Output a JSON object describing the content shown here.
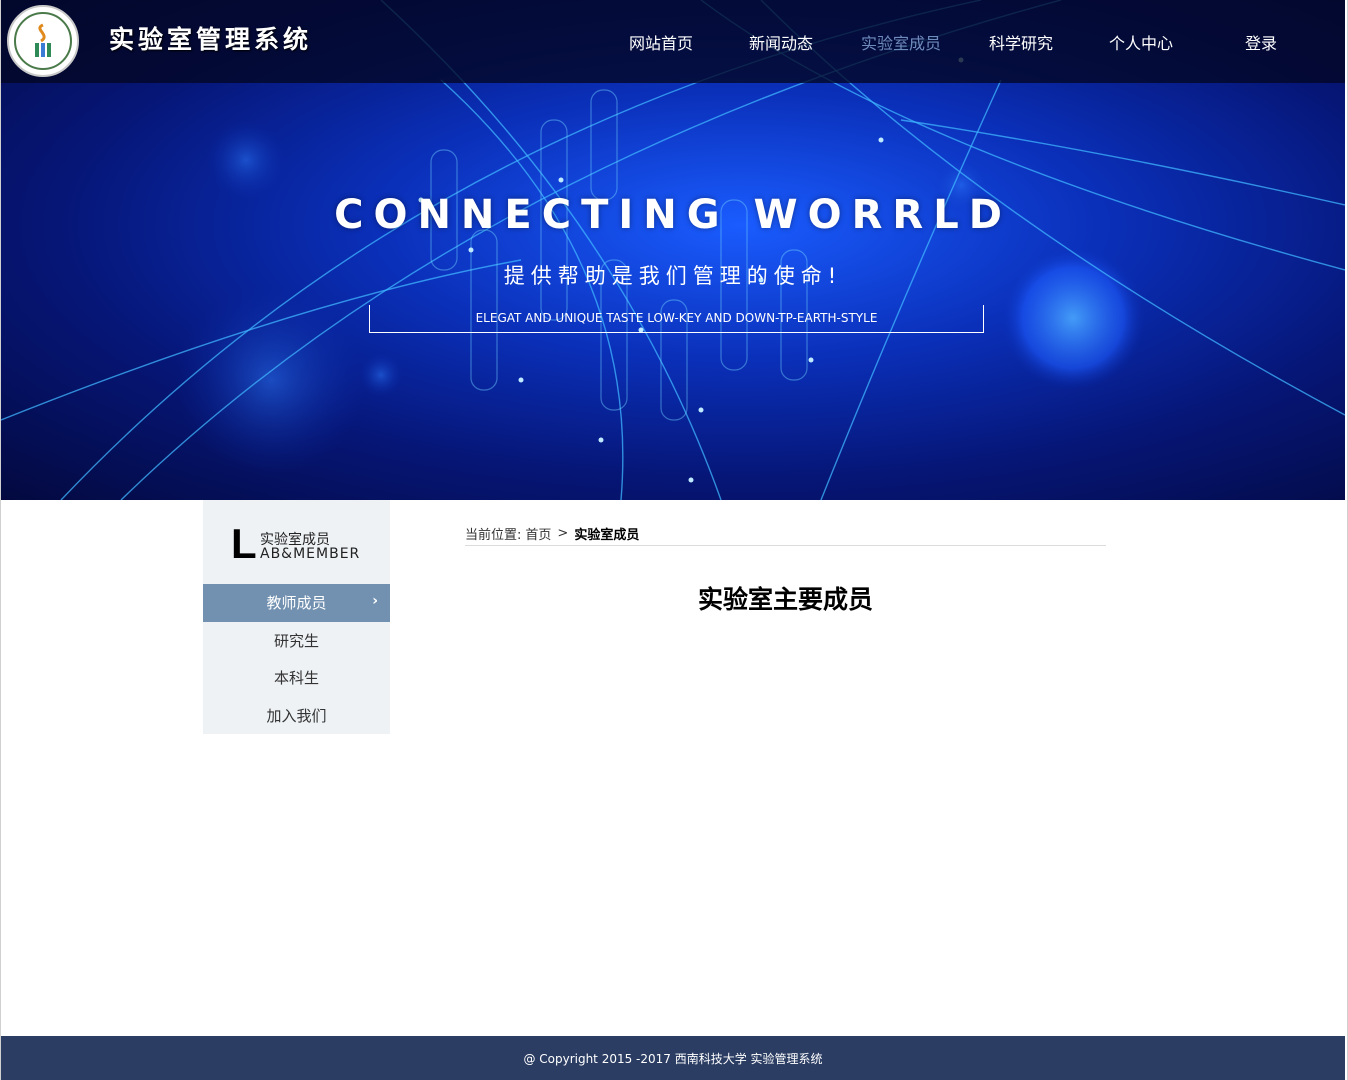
{
  "header": {
    "site_title": "实验室管理系统",
    "nav": [
      {
        "label": "网站首页",
        "active": false
      },
      {
        "label": "新闻动态",
        "active": false
      },
      {
        "label": "实验室成员",
        "active": true
      },
      {
        "label": "科学研究",
        "active": false
      },
      {
        "label": "个人中心",
        "active": false
      },
      {
        "label": "登录",
        "active": false
      }
    ]
  },
  "hero": {
    "title": "CONNECTING WORRLD",
    "subtitle": "提供帮助是我们管理的使命!",
    "tagline": "ELEGAT AND UNIQUE TASTE LOW-KEY AND DOWN-TP-EARTH-STYLE"
  },
  "sidebar": {
    "letter": "L",
    "title_cn": "实验室成员",
    "title_en": "AB&MEMBER",
    "items": [
      {
        "label": "教师成员",
        "active": true
      },
      {
        "label": "研究生",
        "active": false
      },
      {
        "label": "本科生",
        "active": false
      },
      {
        "label": "加入我们",
        "active": false
      }
    ],
    "active_chevron": "›"
  },
  "breadcrumb": {
    "prefix": "当前位置:",
    "home": "首页",
    "separator": ">",
    "current": "实验室成员"
  },
  "main": {
    "title": "实验室主要成员"
  },
  "footer": {
    "copyright": "@ Copyright 2015 -2017 西南科技大学 实验管理系统"
  },
  "colors": {
    "nav_active": "#6f8bbd",
    "sidebar_active": "#7291b0",
    "sidebar_bg": "#eef2f5",
    "footer_bg": "#2b3d63"
  },
  "icons": {
    "logo": "university-seal-icon",
    "chevron": "chevron-right-icon"
  }
}
